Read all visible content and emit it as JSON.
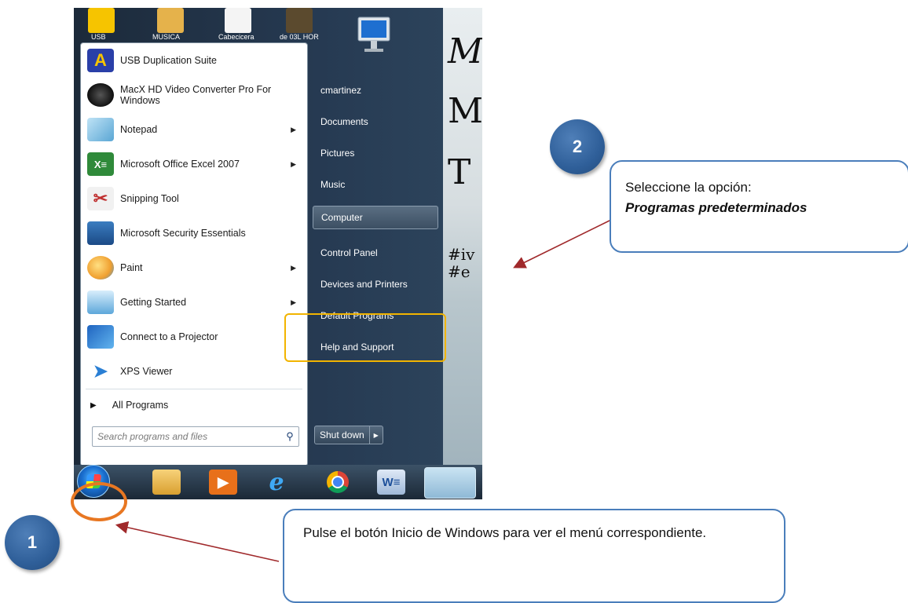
{
  "desktop": {
    "icon_labels": [
      "USB",
      "MUSICA",
      "Cabecicera",
      "de 03L HOR"
    ]
  },
  "wallpaper_text": [
    "M",
    "M",
    "T",
    "#iv",
    "#e"
  ],
  "start_menu": {
    "programs": [
      {
        "label": "USB Duplication Suite",
        "icon": "usb-duplication-icon",
        "has_submenu": false
      },
      {
        "label": "MacX HD Video Converter Pro For Windows",
        "icon": "video-converter-icon",
        "has_submenu": false
      },
      {
        "label": "Notepad",
        "icon": "notepad-icon",
        "has_submenu": true
      },
      {
        "label": "Microsoft Office Excel 2007",
        "icon": "excel-icon",
        "has_submenu": true
      },
      {
        "label": "Snipping Tool",
        "icon": "scissors-icon",
        "has_submenu": false
      },
      {
        "label": "Microsoft Security Essentials",
        "icon": "security-essentials-icon",
        "has_submenu": false
      },
      {
        "label": "Paint",
        "icon": "paint-icon",
        "has_submenu": true
      },
      {
        "label": "Getting Started",
        "icon": "getting-started-icon",
        "has_submenu": true
      },
      {
        "label": "Connect to a Projector",
        "icon": "projector-icon",
        "has_submenu": false
      },
      {
        "label": "XPS Viewer",
        "icon": "xps-viewer-icon",
        "has_submenu": false
      }
    ],
    "all_programs_label": "All Programs",
    "search_placeholder": "Search programs and files",
    "right_links": [
      {
        "label": "cmartinez"
      },
      {
        "label": "Documents"
      },
      {
        "label": "Pictures"
      },
      {
        "label": "Music"
      },
      {
        "label": "Computer"
      },
      {
        "label": "Control Panel"
      },
      {
        "label": "Devices and Printers"
      },
      {
        "label": "Default Programs"
      },
      {
        "label": "Help and Support"
      }
    ],
    "shutdown_label": "Shut down"
  },
  "taskbar": {
    "icons": [
      "start-orb-icon",
      "explorer-icon",
      "media-player-icon",
      "internet-explorer-icon",
      "chrome-icon",
      "word-icon",
      "desktop-app-icon"
    ]
  },
  "callouts": {
    "step1_number": "1",
    "step1_text": "Pulse el botón Inicio de Windows para ver  el menú correspondiente.",
    "step2_number": "2",
    "step2_line1": "Seleccione la opción:",
    "step2_line2": "Programas predeterminados"
  },
  "colors": {
    "highlight": "#f2b400",
    "orb_ring": "#e87722",
    "callout_border": "#4a7ebb",
    "step_circle": "#2f5f99",
    "arrow": "#a0292b"
  }
}
